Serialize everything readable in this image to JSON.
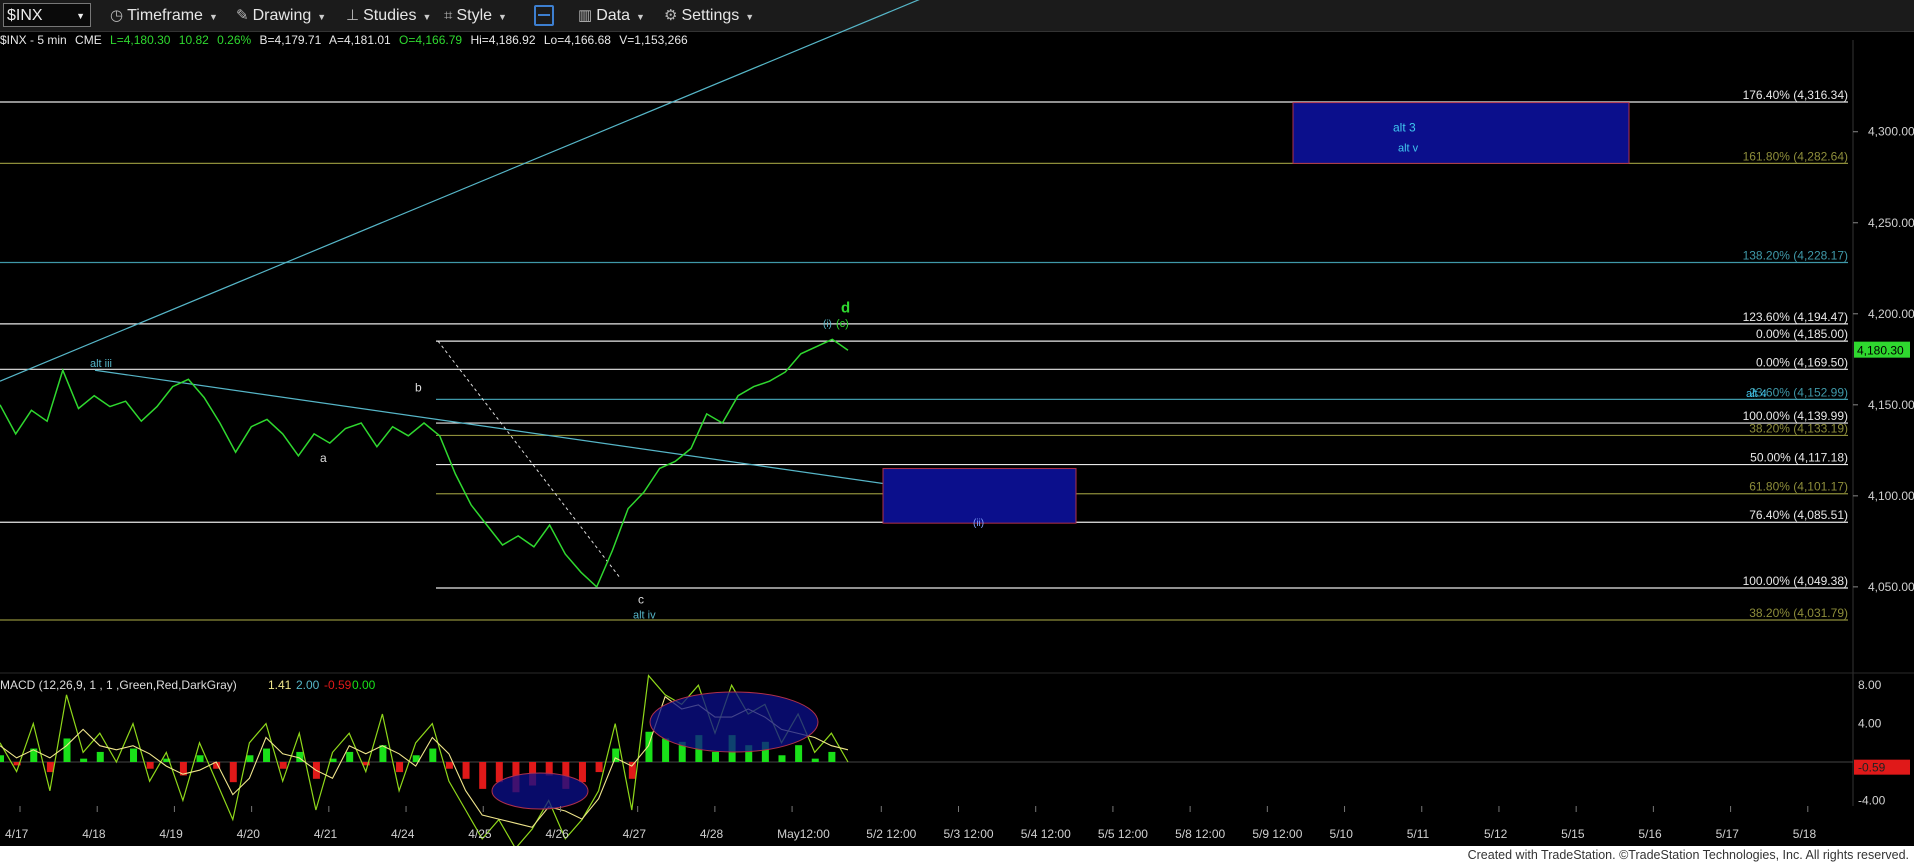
{
  "toolbar": {
    "symbol": "$INX",
    "timeframe": "Timeframe",
    "drawing": "Drawing",
    "studies": "Studies",
    "style": "Style",
    "data": "Data",
    "settings": "Settings"
  },
  "info_bar": {
    "symbol_desc": "$INX - 5 min",
    "exchange": "CME",
    "last": "L=4,180.30",
    "change": "10.82",
    "change_pct": "0.26%",
    "bid": "B=4,179.71",
    "ask": "A=4,181.01",
    "open": "O=4,166.79",
    "high": "Hi=4,186.92",
    "low": "Lo=4,166.68",
    "volume": "V=1,153,266"
  },
  "colors": {
    "price": "#2fd82f",
    "trendline": "#56b6c8",
    "fib_white": "#e8e8e8",
    "fib_olive": "#8d8d3a",
    "fib_teal": "#3f98a8",
    "box_fill": "#0b0f8c",
    "box_border": "#b0304a",
    "last_price_bg": "#2fd82f",
    "macd_line": "#8fd81a",
    "signal_line": "#f0e68c",
    "hist_up": "#19e019",
    "hist_down": "#e01919"
  },
  "chart_data": {
    "type": "line",
    "price_axis": {
      "ticks": [
        "4,300.00",
        "4,250.00",
        "4,200.00",
        "4,150.00",
        "4,100.00",
        "4,050.00"
      ],
      "tick_values": [
        4300,
        4250,
        4200,
        4150,
        4100,
        4050
      ],
      "last_price": "4,180.30",
      "last_value": 4180.3
    },
    "date_axis": [
      "4/17",
      "4/18",
      "4/19",
      "4/20",
      "4/21",
      "4/24",
      "4/25",
      "4/26",
      "4/27",
      "4/28",
      "May12:00",
      "5/2 12:00",
      "5/3 12:00",
      "5/4 12:00",
      "5/5 12:00",
      "5/8 12:00",
      "5/9 12:00",
      "5/10",
      "5/11",
      "5/12",
      "5/15",
      "5/16",
      "5/17",
      "5/18"
    ],
    "fib_levels": [
      {
        "label": "176.40% (4,316.34)",
        "value": 4316.34,
        "color": "white"
      },
      {
        "label": "161.80% (4,282.64)",
        "value": 4282.64,
        "color": "olive"
      },
      {
        "label": "138.20% (4,228.17)",
        "value": 4228.17,
        "color": "teal"
      },
      {
        "label": "123.60% (4,194.47)",
        "value": 4194.47,
        "color": "white"
      },
      {
        "label": "0.00% (4,185.00)",
        "value": 4185.0,
        "color": "white"
      },
      {
        "label": "0.00% (4,169.50)",
        "value": 4169.5,
        "color": "white"
      },
      {
        "label": "23.60% (4,152.99)",
        "value": 4152.99,
        "color": "teal"
      },
      {
        "label": "100.00% (4,139.99)",
        "value": 4139.99,
        "color": "white"
      },
      {
        "label": "38.20% (4,133.19)",
        "value": 4133.19,
        "color": "olive"
      },
      {
        "label": "50.00% (4,117.18)",
        "value": 4117.18,
        "color": "white"
      },
      {
        "label": "61.80% (4,101.17)",
        "value": 4101.17,
        "color": "olive"
      },
      {
        "label": "76.40% (4,085.51)",
        "value": 4085.51,
        "color": "white"
      },
      {
        "label": "100.00% (4,049.38)",
        "value": 4049.38,
        "color": "white"
      },
      {
        "label": "38.20% (4,031.79)",
        "value": 4031.79,
        "color": "olive"
      }
    ],
    "wave_labels": [
      "alt iii",
      "a",
      "b",
      "c",
      "alt iv",
      "(i)",
      "(c)",
      "d",
      "alt 4",
      "alt 3",
      "alt v",
      "(ii)"
    ],
    "price_path": [
      4150,
      4134,
      4147,
      4141,
      4169,
      4148,
      4155,
      4149,
      4152,
      4141,
      4149,
      4160,
      4164,
      4154,
      4140,
      4124,
      4138,
      4142,
      4134,
      4122,
      4134,
      4129,
      4137,
      4140,
      4127,
      4138,
      4133,
      4140,
      4133,
      4112,
      4095,
      4084,
      4073,
      4078,
      4072,
      4084,
      4068,
      4058,
      4050,
      4070,
      4093,
      4102,
      4115,
      4119,
      4126,
      4145,
      4140,
      4155,
      4160,
      4163,
      4168,
      4178,
      4182,
      4186,
      4180
    ],
    "macd": {
      "label": "MACD (12,26,9, 1 , 1 ,Green,Red,DarkGray)",
      "values": [
        "1.41",
        "2.00",
        "-0.59",
        "0.00"
      ],
      "axis_ticks": [
        "8.00",
        "4.00",
        "-4.00"
      ],
      "axis_values": [
        8,
        4,
        -4
      ],
      "last": "-0.59",
      "macd_line": [
        2,
        -1,
        4,
        -3,
        7,
        1,
        3,
        0,
        4,
        -2,
        1,
        -4,
        2,
        -2,
        -6,
        2,
        4,
        -2,
        3,
        -5,
        1,
        3,
        -1,
        5,
        -3,
        2,
        4,
        -2,
        -5,
        -8,
        -6,
        -9,
        -7,
        -4,
        -8,
        -6,
        -3,
        4,
        -5,
        9,
        7,
        6,
        8,
        3,
        8,
        5,
        6,
        2,
        5,
        1,
        3,
        0
      ]
    }
  },
  "footer": {
    "text": "Created with TradeStation. ©TradeStation Technologies, Inc. All rights reserved."
  }
}
